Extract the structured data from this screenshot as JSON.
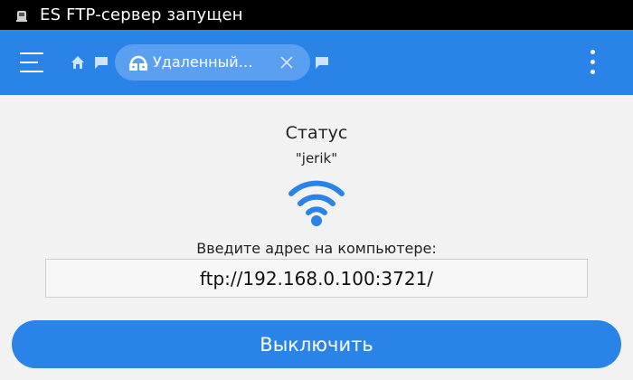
{
  "statusbar": {
    "notification_icon": "ftp-server-icon",
    "title": "ES FTP-сервер запущен"
  },
  "toolbar": {
    "menu_icon": "hamburger-icon",
    "home_icon": "home-icon",
    "chat_icon": "chat-icon",
    "tab": {
      "icon": "remote-lock-icon",
      "label": "Удаленный…",
      "close_icon": "close-icon"
    },
    "more_icon": "more-vertical-icon",
    "accent_color": "#2a84e8"
  },
  "main": {
    "status_title": "Статус",
    "username": "\"jerik\"",
    "wifi_icon": "wifi-icon",
    "hint": "Введите адрес на компьютере:",
    "address": "ftp://192.168.0.100:3721/",
    "off_button_label": "Выключить"
  }
}
